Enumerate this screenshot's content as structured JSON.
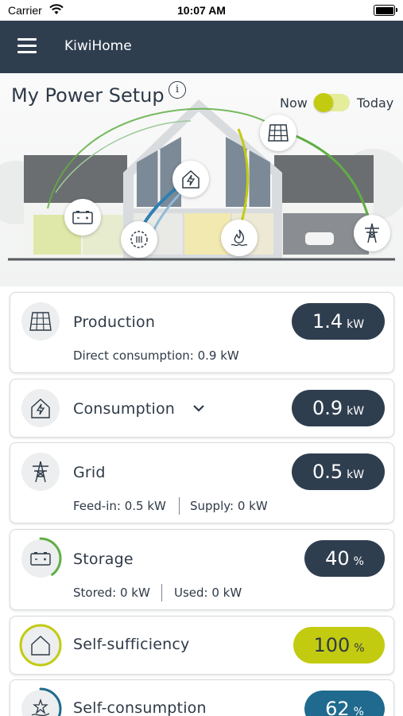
{
  "status_bar": {
    "carrier": "Carrier",
    "time": "10:07 AM"
  },
  "app_bar": {
    "title": "KiwiHome"
  },
  "hero": {
    "title": "My Power Setup",
    "info_glyph": "i",
    "toggle": {
      "left_label": "Now",
      "right_label": "Today",
      "selected": "Now"
    }
  },
  "cards": {
    "production": {
      "title": "Production",
      "value": "1.4",
      "unit": "kW",
      "sub": "Direct consumption: 0.9 kW",
      "icon": "solar-panel-icon"
    },
    "consumption": {
      "title": "Consumption",
      "value": "0.9",
      "unit": "kW",
      "icon": "house-lightning-icon"
    },
    "grid": {
      "title": "Grid",
      "value": "0.5",
      "unit": "kW",
      "feed_in": "Feed-in: 0.5 kW",
      "supply": "Supply: 0 kW",
      "icon": "power-pylon-icon"
    },
    "storage": {
      "title": "Storage",
      "value": "40",
      "unit": "%",
      "level": 0.4,
      "stored": "Stored: 0 kW",
      "used": "Used: 0 kW",
      "icon": "battery-icon"
    },
    "self_sufficiency": {
      "title": "Self-sufficiency",
      "value": "100",
      "unit": "%",
      "level": 1.0,
      "icon": "house-outline-icon"
    },
    "self_consumption": {
      "title": "Self-consumption",
      "value": "62",
      "unit": "%",
      "level": 0.62,
      "icon": "hand-star-icon"
    }
  },
  "colors": {
    "navy": "#2f3e4f",
    "lime": "#c2cb10",
    "teal_blue": "#1f6a8e",
    "green": "#5fae44",
    "light_gray": "#eceeef"
  }
}
